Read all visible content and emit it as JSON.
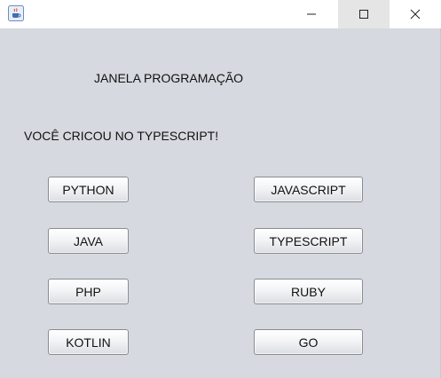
{
  "window": {
    "icon": "java-cup-icon",
    "controls": [
      "minimize-icon",
      "maximize-icon",
      "close-icon"
    ]
  },
  "labels": {
    "title": "JANELA PROGRAMAÇÃO",
    "status": "VOCÊ CRICOU NO TYPESCRIPT!"
  },
  "buttons": {
    "python": "PYTHON",
    "java": "JAVA",
    "php": "PHP",
    "kotlin": "KOTLIN",
    "javascript": "JAVASCRIPT",
    "typescript": "TYPESCRIPT",
    "ruby": "RUBY",
    "go": "GO"
  },
  "colors": {
    "client_background": "#d6d9df",
    "maximize_hover": "#e5e5e5"
  }
}
